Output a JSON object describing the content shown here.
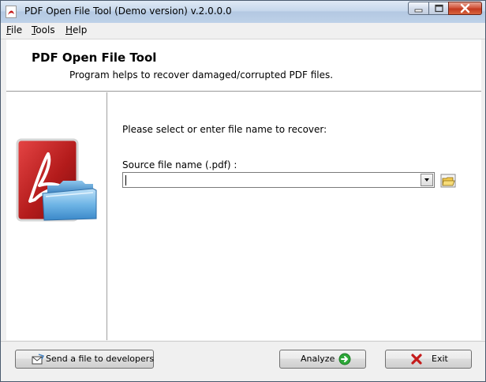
{
  "window": {
    "title": "PDF Open File Tool (Demo version) v.2.0.0.0"
  },
  "menu": [
    {
      "label": "File",
      "mnemonic": "F",
      "rest": "ile"
    },
    {
      "label": "Tools",
      "mnemonic": "T",
      "rest": "ools"
    },
    {
      "label": "Help",
      "mnemonic": "H",
      "rest": "elp"
    }
  ],
  "header": {
    "title": "PDF Open File Tool",
    "subtitle": "Program helps to recover damaged/corrupted PDF files."
  },
  "main": {
    "prompt": "Please select or enter file name to recover:",
    "source_label": "Source file name (.pdf) :",
    "source_value": ""
  },
  "buttons": {
    "send": "Send a file to developers",
    "analyze": "Analyze",
    "exit": "Exit"
  },
  "icons": {
    "app": "pdf-icon",
    "logo": "pdf-folder-logo",
    "browse": "open-folder-icon",
    "send": "envelope-icon",
    "analyze": "arrow-right-icon",
    "exit": "x-icon"
  },
  "colors": {
    "pdf_red": "#b31b1b",
    "folder_blue": "#5aa9e0",
    "analyze_green": "#2ea83a",
    "exit_red": "#c41a1a"
  }
}
